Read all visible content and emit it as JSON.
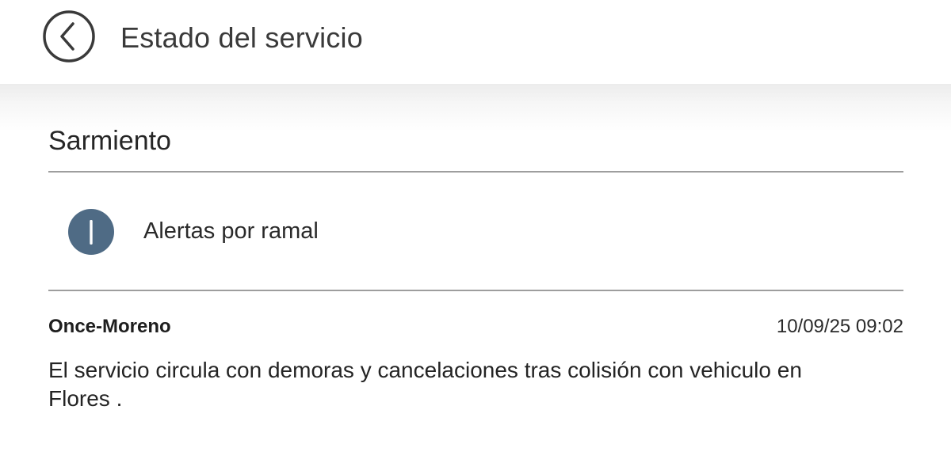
{
  "app_bar": {
    "title": "Estado del servicio",
    "back_icon": "chevron-left-circle-icon"
  },
  "section": {
    "title": "Sarmiento"
  },
  "alerts_row": {
    "icon": "info-icon",
    "label": "Alertas por ramal"
  },
  "alerts": [
    {
      "line": "Once-Moreno",
      "timestamp": "10/09/25 09:02",
      "message": "El servicio circula con demoras y cancelaciones tras colisión con vehiculo en Flores ."
    }
  ],
  "colors": {
    "info_icon_bg": "#4f6b85",
    "divider": "#9e9e9e",
    "text": "#222222"
  }
}
